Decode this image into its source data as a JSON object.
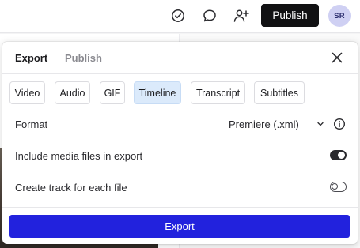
{
  "topbar": {
    "publish_label": "Publish",
    "avatar_initials": "SR",
    "icons": [
      "check-circle-icon",
      "comment-icon",
      "add-person-icon"
    ]
  },
  "modal": {
    "tabs": [
      {
        "label": "Export",
        "active": true
      },
      {
        "label": "Publish",
        "active": false
      }
    ],
    "format_tabs": [
      {
        "label": "Video",
        "selected": false
      },
      {
        "label": "Audio",
        "selected": false
      },
      {
        "label": "GIF",
        "selected": false
      },
      {
        "label": "Timeline",
        "selected": true
      },
      {
        "label": "Transcript",
        "selected": false
      },
      {
        "label": "Subtitles",
        "selected": false
      }
    ],
    "format": {
      "label": "Format",
      "value": "Premiere (.xml)"
    },
    "options": [
      {
        "label": "Include media files in export",
        "enabled": true
      },
      {
        "label": "Create track for each file",
        "enabled": false
      }
    ],
    "export_label": "Export"
  },
  "colors": {
    "accent": "#2222dd",
    "selected_tab_bg": "#dbeafb",
    "publish_button_bg": "#111113",
    "avatar_bg": "#cfd0f3"
  }
}
